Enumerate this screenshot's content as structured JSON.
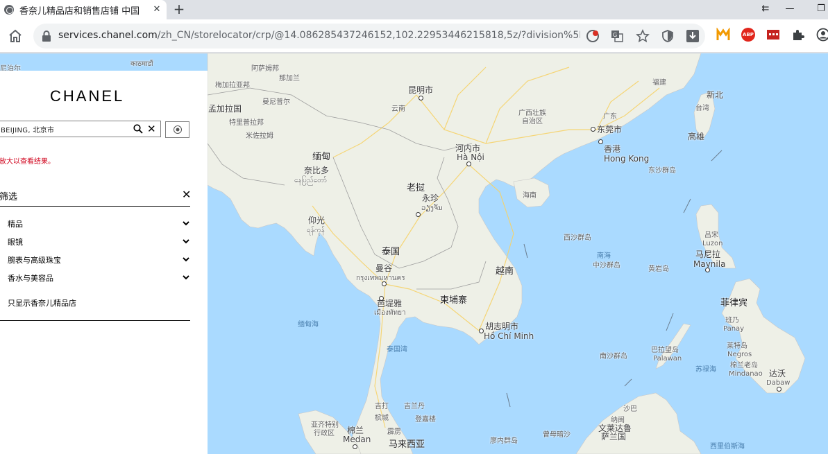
{
  "browser": {
    "tab_title": "香奈儿精品店和销售店铺 中国",
    "new_tab_label": "+",
    "window_controls": {
      "restore_label": "⇇",
      "minimize_label": "—",
      "maximize_label": "❐"
    },
    "url_host": "services.chanel.com",
    "url_path": "/zh_CN/storelocator/crp/@14.086285437246152,102.22953446215818,5z/?division%5B%5D=1&pro...",
    "extensions": [
      "m-icon",
      "abp-icon",
      "grid-ext-icon",
      "puzzle-icon",
      "profile-icon"
    ],
    "abp_label": "ABP"
  },
  "panel": {
    "brand": "CHANEL",
    "search": {
      "value": "BEIJING, 北京市"
    },
    "zoom_message": "放大以查看结果。",
    "filter": {
      "title": "筛选",
      "close_label": "✕",
      "items": [
        {
          "label": "精品"
        },
        {
          "label": "眼镜"
        },
        {
          "label": "腕表与高级珠宝"
        },
        {
          "label": "香水与美容品"
        }
      ],
      "only_boutiques_label": "只显示香奈儿精品店"
    }
  },
  "map": {
    "labels": {
      "nepal": "尼泊尔",
      "kathmandu": "काठमाडौं",
      "sikkim_area": "阿萨姆邦",
      "meghalaya": "梅加拉亚邦",
      "nagaland": "那加兰",
      "bangladesh": "孟加拉国",
      "manipur": "曼尼普尔",
      "tripura": "特里普拉邦",
      "mizoram": "米佐拉姆",
      "myanmar": "缅甸",
      "naypyidaw": "奈比多",
      "naypyidaw_local": "နေပြည်တော်",
      "yangon": "仰光",
      "yangon_local": "ရန်ကုန်",
      "kunming": "昆明市",
      "yunnan": "云南",
      "guangxi": "广西壮族",
      "guangxi2": "自治区",
      "guangdong": "广东",
      "fujian": "福建",
      "xinbei": "新北",
      "taiwan": "台湾",
      "kaohsiung": "高雄",
      "dongguan": "东莞市",
      "hongkong": "香港",
      "hongkong_en": "Hong Kong",
      "dongsha": "东沙群岛",
      "hanoi": "河内市",
      "hanoi_local": "Hà Nội",
      "hainan": "海南",
      "laos": "老挝",
      "vientiane": "永珍",
      "vientiane_local": "ວຽງຈັນ",
      "thailand": "泰国",
      "bangkok": "曼谷",
      "bangkok_local": "กรุงเทพมหานคร",
      "pattaya": "芭堤雅",
      "pattaya_local": "เมืองพัทยา",
      "cambodia": "柬埔寨",
      "vietnam": "越南",
      "hcmc": "胡志明市",
      "hcmc_local": "Hồ Chí Minh",
      "xisha": "西沙群岛",
      "south_china_sea": "南海",
      "zhongsha": "中沙群岛",
      "huangyan": "黄岩岛",
      "luzon": "吕宋",
      "luzon_en": "Luzon",
      "manila": "马尼拉",
      "manila_en": "Maynila",
      "philippines": "菲律宾",
      "panay": "班乃",
      "panay_en": "Panay",
      "negros": "莱特岛",
      "negros_en": "Negros",
      "mindanao": "棉兰老岛",
      "mindanao_en": "Mindanao",
      "davao": "达沃",
      "davao_en": "Dabaw",
      "palawan": "巴拉望岛",
      "palawan_en": "Palawan",
      "sulu_sea": "苏禄海",
      "nansha": "南沙群岛",
      "andaman_sea": "缅甸海",
      "gulf_thailand": "泰国湾",
      "kedah": "吉打",
      "perlis": "槟城",
      "kelantan": "吉兰丹",
      "terengganu": "登嘉楼",
      "aceh": "亚齐特别",
      "aceh2": "行政区",
      "medan": "棉兰",
      "medan_en": "Medan",
      "perak": "霹雳",
      "malaysia": "马来西亚",
      "anambas": "廖内群岛",
      "natuna": "曾母暗沙",
      "sabah": "沙巴",
      "brunei": "文莱达鲁",
      "brunei2": "萨兰国",
      "sarawak": "纳闽",
      "celebes_sea": "西里伯斯海"
    }
  }
}
